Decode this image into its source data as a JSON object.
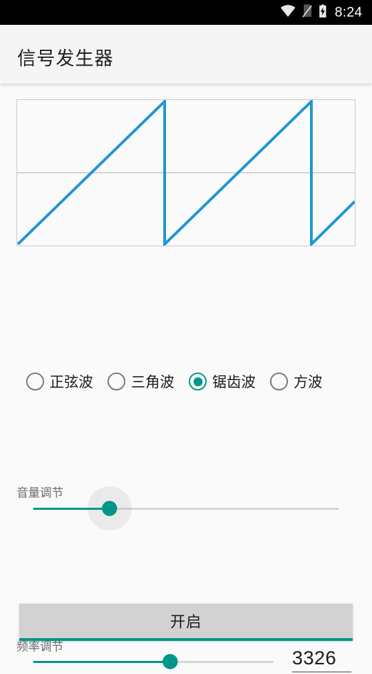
{
  "status_bar": {
    "time": "8:24",
    "icons": [
      "wifi-icon",
      "sim-card-off-icon",
      "battery-charging-icon"
    ]
  },
  "app_bar": {
    "title": "信号发生器"
  },
  "waveform": {
    "type": "sawtooth",
    "line_color": "#1f96d4",
    "border_color": "#c8c8c8",
    "axis_color": "#b4b4b4",
    "cycles": "2.3"
  },
  "wave_types": {
    "options": [
      {
        "label": "正弦波",
        "value": "sine",
        "selected": false
      },
      {
        "label": "三角波",
        "value": "triangle",
        "selected": false
      },
      {
        "label": "锯齿波",
        "value": "sawtooth",
        "selected": true
      },
      {
        "label": "方波",
        "value": "square",
        "selected": false
      }
    ],
    "selected_color": "#009688"
  },
  "volume": {
    "label": "音量调节",
    "percent": 25,
    "active_color": "#009688",
    "track_color": "#d6d6d6"
  },
  "frequency": {
    "label": "频率调节",
    "percent": 57,
    "value": "3326",
    "active_color": "#009688",
    "track_color": "#d6d6d6"
  },
  "action_button": {
    "label": "开启",
    "accent_color": "#009688"
  },
  "chart_data": {
    "type": "line",
    "title": "",
    "xlabel": "",
    "ylabel": "",
    "series": [
      {
        "name": "锯齿波",
        "x": [
          0,
          0.455,
          0.455,
          0.912,
          0.912,
          1.0
        ],
        "y": [
          -1,
          1,
          -1,
          1,
          -1,
          -0.62
        ]
      }
    ],
    "ylim": [
      -1,
      1
    ],
    "xlim": [
      0,
      1
    ],
    "grid": false,
    "zero_line": true
  }
}
